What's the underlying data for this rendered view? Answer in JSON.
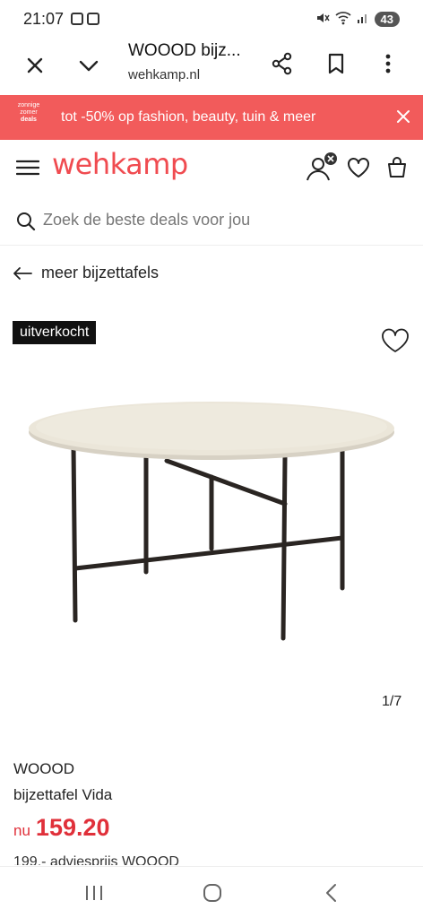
{
  "status_bar": {
    "time": "21:07",
    "battery": "43",
    "icons": [
      "notification-icon",
      "screenshot-icon",
      "mute-icon",
      "wifi-icon",
      "signal-icon"
    ]
  },
  "browser": {
    "title": "WOOOD bijz...",
    "url": "wehkamp.nl"
  },
  "promo": {
    "badge_line1": "zonnige",
    "badge_line2": "zomer",
    "badge_line3": "deals",
    "text": "tot -50% op fashion, beauty, tuin & meer",
    "color": "#f25b5b"
  },
  "header": {
    "logo": "wehkamp",
    "brand_color": "#f04b50"
  },
  "search": {
    "placeholder": "Zoek de beste deals voor jou"
  },
  "back_link": {
    "label": "meer bijzettafels"
  },
  "product": {
    "status_tag": "uitverkocht",
    "image_counter": "1/7",
    "brand": "WOOOD",
    "name": "bijzettafel Vida",
    "price_prefix": "nu",
    "price": "159.20",
    "advice_text": "199,- adviesprijs WOOOD",
    "price_color": "#e0303a"
  }
}
